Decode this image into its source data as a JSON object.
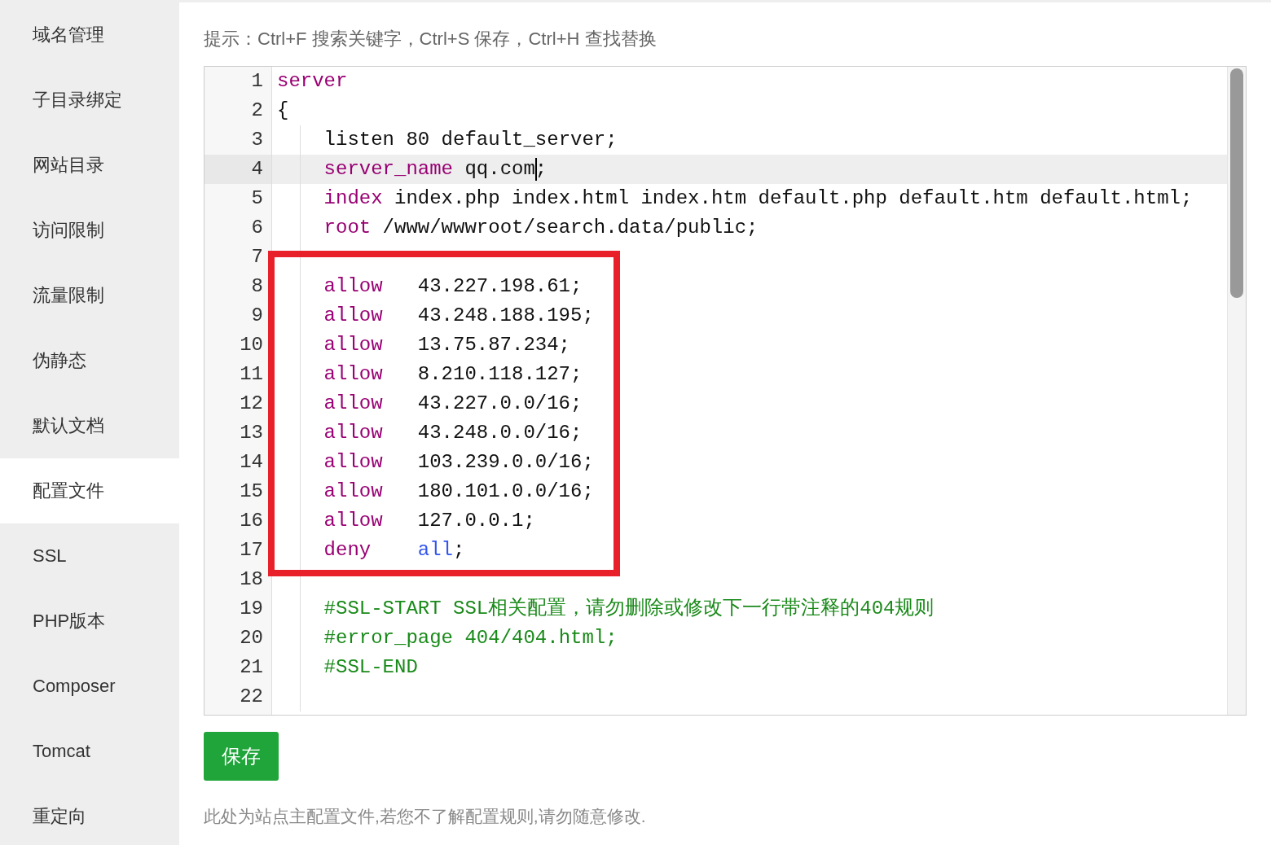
{
  "sidebar": {
    "items": [
      {
        "label": "域名管理",
        "selected": false
      },
      {
        "label": "子目录绑定",
        "selected": false
      },
      {
        "label": "网站目录",
        "selected": false
      },
      {
        "label": "访问限制",
        "selected": false
      },
      {
        "label": "流量限制",
        "selected": false
      },
      {
        "label": "伪静态",
        "selected": false
      },
      {
        "label": "默认文档",
        "selected": false
      },
      {
        "label": "配置文件",
        "selected": true
      },
      {
        "label": "SSL",
        "selected": false
      },
      {
        "label": "PHP版本",
        "selected": false
      },
      {
        "label": "Composer",
        "selected": false
      },
      {
        "label": "Tomcat",
        "selected": false
      },
      {
        "label": "重定向",
        "selected": false
      }
    ]
  },
  "hint": "提示：Ctrl+F 搜索关键字，Ctrl+S 保存，Ctrl+H 查找替换",
  "editor": {
    "lines": [
      {
        "number": "1",
        "active": false,
        "boxed": false,
        "tokens": [
          {
            "kind": "keyword",
            "text": "server"
          }
        ]
      },
      {
        "number": "2",
        "active": false,
        "boxed": false,
        "tokens": [
          {
            "kind": "plain",
            "text": "{"
          }
        ],
        "children": [
          {
            "number": "3",
            "active": false,
            "boxed": false,
            "tokens": [
              {
                "kind": "plain",
                "text": "listen 80 default_server;"
              }
            ]
          },
          {
            "number": "4",
            "active": true,
            "boxed": false,
            "tokens": [
              {
                "kind": "keyword",
                "text": "server_name"
              },
              {
                "kind": "plain",
                "text": " qq.com",
                "cursor": true
              },
              {
                "kind": "plain",
                "text": ";"
              }
            ]
          },
          {
            "number": "5",
            "active": false,
            "boxed": false,
            "tokens": [
              {
                "kind": "keyword",
                "text": "index"
              },
              {
                "kind": "plain",
                "text": " index.php index.html index.htm default.php default.htm default.html;"
              }
            ]
          },
          {
            "number": "6",
            "active": false,
            "boxed": false,
            "tokens": [
              {
                "kind": "keyword",
                "text": "root"
              },
              {
                "kind": "plain",
                "text": " /www/wwwroot/search.data/public;"
              }
            ]
          },
          {
            "number": "7",
            "active": false,
            "boxed": false
          },
          {
            "number": "8",
            "active": false,
            "boxed": true,
            "tokens": [
              {
                "kind": "directive",
                "text": "allow"
              },
              {
                "kind": "plain",
                "text": "43.227.198.61;"
              }
            ]
          },
          {
            "number": "9",
            "active": false,
            "boxed": true,
            "tokens": [
              {
                "kind": "directive",
                "text": "allow"
              },
              {
                "kind": "plain",
                "text": "43.248.188.195;"
              }
            ]
          },
          {
            "number": "10",
            "active": false,
            "boxed": true,
            "tokens": [
              {
                "kind": "directive",
                "text": "allow"
              },
              {
                "kind": "plain",
                "text": "13.75.87.234;"
              }
            ]
          },
          {
            "number": "11",
            "active": false,
            "boxed": true,
            "tokens": [
              {
                "kind": "directive",
                "text": "allow"
              },
              {
                "kind": "plain",
                "text": "8.210.118.127;"
              }
            ]
          },
          {
            "number": "12",
            "active": false,
            "boxed": true,
            "tokens": [
              {
                "kind": "directive",
                "text": "allow"
              },
              {
                "kind": "plain",
                "text": "43.227.0.0/16;"
              }
            ]
          },
          {
            "number": "13",
            "active": false,
            "boxed": true,
            "tokens": [
              {
                "kind": "directive",
                "text": "allow"
              },
              {
                "kind": "plain",
                "text": "43.248.0.0/16;"
              }
            ]
          },
          {
            "number": "14",
            "active": false,
            "boxed": true,
            "tokens": [
              {
                "kind": "directive",
                "text": "allow"
              },
              {
                "kind": "plain",
                "text": "103.239.0.0/16;"
              }
            ]
          },
          {
            "number": "15",
            "active": false,
            "boxed": true,
            "tokens": [
              {
                "kind": "directive",
                "text": "allow"
              },
              {
                "kind": "plain",
                "text": "180.101.0.0/16;"
              }
            ]
          },
          {
            "number": "16",
            "active": false,
            "boxed": true,
            "tokens": [
              {
                "kind": "directive",
                "text": "allow"
              },
              {
                "kind": "plain",
                "text": "127.0.0.1;"
              }
            ]
          },
          {
            "number": "17",
            "active": false,
            "boxed": true,
            "tokens": [
              {
                "kind": "directive",
                "text": "deny"
              },
              {
                "kind": "atom",
                "text": "all"
              },
              {
                "kind": "plain",
                "text": ";"
              }
            ]
          },
          {
            "number": "18",
            "active": false,
            "boxed": false
          },
          {
            "number": "19",
            "active": false,
            "boxed": false,
            "tokens": [
              {
                "kind": "comment",
                "text": "#SSL-START SSL相关配置，请勿删除或修改下一行带注释的404规则"
              }
            ]
          },
          {
            "number": "20",
            "active": false,
            "boxed": false,
            "tokens": [
              {
                "kind": "comment",
                "text": "#error_page 404/404.html;"
              }
            ]
          },
          {
            "number": "21",
            "active": false,
            "boxed": false,
            "tokens": [
              {
                "kind": "comment",
                "text": "#SSL-END"
              }
            ]
          },
          {
            "number": "22",
            "active": false,
            "boxed": false
          }
        ]
      }
    ]
  },
  "save_button": "保存",
  "note": "此处为站点主配置文件,若您不了解配置规则,请勿随意修改."
}
